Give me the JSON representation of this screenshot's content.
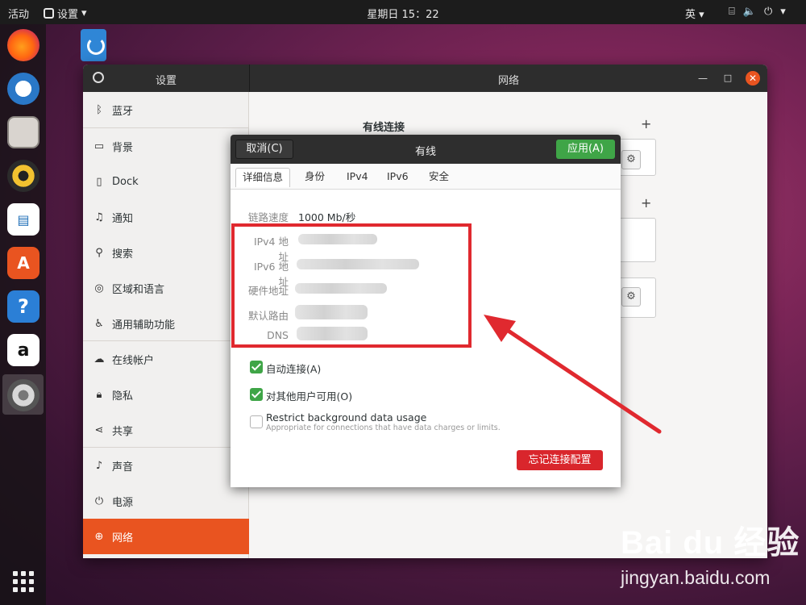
{
  "topbar": {
    "activities": "活动",
    "app_menu": "设置",
    "clock": "星期日 15：22",
    "lang": "英"
  },
  "window": {
    "sidebar_title": "设置",
    "content_title": "网络",
    "sidebar_items": [
      {
        "label": "蓝牙",
        "icon": "bluetooth-icon"
      },
      {
        "label": "背景",
        "icon": "monitor-icon"
      },
      {
        "label": "Dock",
        "icon": "dock-icon"
      },
      {
        "label": "通知",
        "icon": "bell-icon"
      },
      {
        "label": "搜索",
        "icon": "search-icon"
      },
      {
        "label": "区域和语言",
        "icon": "globe-icon"
      },
      {
        "label": "通用辅助功能",
        "icon": "accessibility-icon"
      },
      {
        "label": "在线帐户",
        "icon": "cloud-icon"
      },
      {
        "label": "隐私",
        "icon": "lock-icon"
      },
      {
        "label": "共享",
        "icon": "share-icon"
      },
      {
        "label": "声音",
        "icon": "music-icon"
      },
      {
        "label": "电源",
        "icon": "power-icon"
      },
      {
        "label": "网络",
        "icon": "network-icon",
        "active": true
      }
    ],
    "wired_heading": "有线连接",
    "plus_1": "+",
    "plus_2": "+"
  },
  "dialog": {
    "title": "有线",
    "cancel": "取消(C)",
    "apply": "应用(A)",
    "tabs": [
      "详细信息",
      "身份",
      "IPv4",
      "IPv6",
      "安全"
    ],
    "selected_tab": 0,
    "link_speed_label": "链路速度",
    "link_speed_value": "1000 Mb/秒",
    "ipv4_label": "IPv4 地址",
    "ipv6_label": "IPv6 地址",
    "hw_label": "硬件地址",
    "route_label": "默认路由",
    "dns_label": "DNS",
    "auto_connect": "自动连接(A)",
    "auto_connect_checked": true,
    "all_users": "对其他用户可用(O)",
    "all_users_checked": true,
    "restrict": "Restrict background data usage",
    "restrict_sub": "Appropriate for connections that have data charges or limits.",
    "restrict_checked": false,
    "forget": "忘记连接配置"
  },
  "watermark": {
    "logo": "Bai du 经验",
    "url": "jingyan.baidu.com"
  },
  "colors": {
    "accent": "#e95420",
    "apply_green": "#3fa547",
    "annotation_red": "#e0292f"
  }
}
